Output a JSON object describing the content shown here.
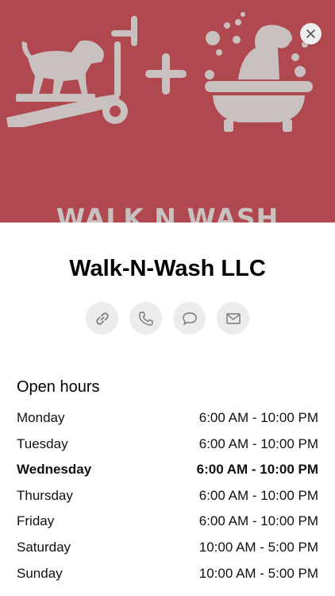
{
  "business": {
    "name": "Walk-N-Wash LLC",
    "banner_text": "WALK N WASH"
  },
  "colors": {
    "banner_bg": "#b04850",
    "artwork": "#c9c0c0"
  },
  "actions": [
    {
      "icon": "link-icon"
    },
    {
      "icon": "phone-icon"
    },
    {
      "icon": "message-icon"
    },
    {
      "icon": "mail-icon"
    }
  ],
  "hours": {
    "heading": "Open hours",
    "days": [
      {
        "day": "Monday",
        "time": "6:00 AM - 10:00 PM"
      },
      {
        "day": "Tuesday",
        "time": "6:00 AM - 10:00 PM"
      },
      {
        "day": "Wednesday",
        "time": "6:00 AM - 10:00 PM"
      },
      {
        "day": "Thursday",
        "time": "6:00 AM - 10:00 PM"
      },
      {
        "day": "Friday",
        "time": "6:00 AM - 10:00 PM"
      },
      {
        "day": "Saturday",
        "time": "10:00 AM - 5:00 PM"
      },
      {
        "day": "Sunday",
        "time": "10:00 AM - 5:00 PM"
      }
    ]
  }
}
